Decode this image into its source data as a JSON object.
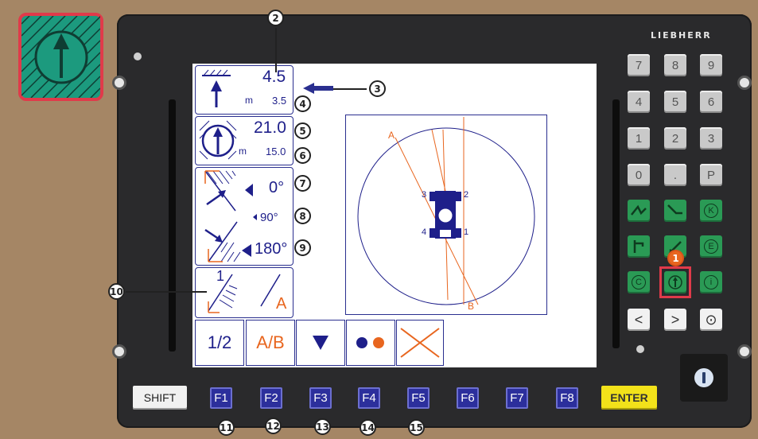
{
  "brand": "LIEBHERR",
  "display": {
    "height_value": "4.5",
    "height_unit": "m",
    "height_limit": "3.5",
    "radius_value": "21.0",
    "radius_unit": "m",
    "radius_limit": "15.0",
    "angle_left": "0°",
    "angle_mid": "90°",
    "angle_right": "180°",
    "wall_number": "1",
    "wall_letter": "A",
    "plan_label_a": "A",
    "plan_label_b": "B",
    "plan_num_1": "1",
    "plan_num_2": "2",
    "plan_num_3": "3",
    "plan_num_4": "4",
    "softkeys": [
      "1/2",
      "A/B"
    ]
  },
  "keypad": {
    "digits": [
      "7",
      "8",
      "9",
      "4",
      "5",
      "6",
      "1",
      "2",
      "3",
      "0",
      ".",
      "P"
    ],
    "green_letters": [
      "K",
      "E",
      "C",
      "i"
    ],
    "nav": [
      "<",
      ">",
      "⊙"
    ]
  },
  "function_keys": {
    "shift": "SHIFT",
    "f": [
      "F1",
      "F2",
      "F3",
      "F4",
      "F5",
      "F6",
      "F7",
      "F8"
    ],
    "enter": "ENTER"
  },
  "callouts": [
    "1",
    "2",
    "3",
    "4",
    "5",
    "6",
    "7",
    "8",
    "9",
    "10",
    "11",
    "12",
    "13",
    "14",
    "15"
  ],
  "colors": {
    "background": "#a58665",
    "panel": "#2a2a2c",
    "screen_blue": "#1e1f8a",
    "accent_orange": "#e8661f",
    "key_green": "#2a9a55",
    "highlight_red": "#e03a4a",
    "enter_yellow": "#f2e21a"
  },
  "icons": [
    "work-area-icon",
    "height-limit-icon",
    "radius-limit-icon",
    "slew-limit-icon",
    "wall-limit-icon",
    "arrow-down-icon",
    "dots-icon",
    "cross-icon",
    "on-off-icon"
  ]
}
